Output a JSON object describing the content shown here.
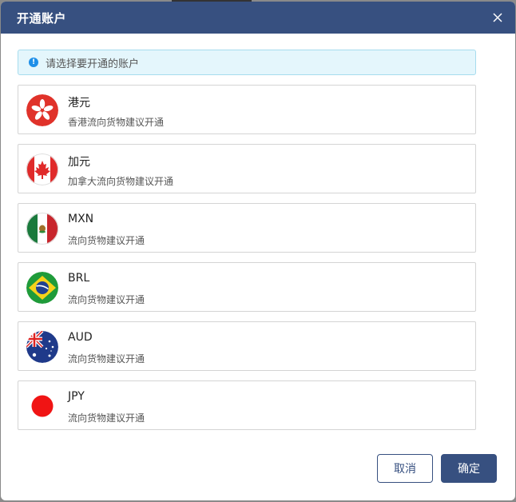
{
  "dialog": {
    "title": "开通账户"
  },
  "notice": {
    "text": "请选择要开通的账户"
  },
  "accounts": [
    {
      "currency": "港元",
      "description": "香港流向货物建议开通",
      "flag": "hong-kong-flag"
    },
    {
      "currency": "加元",
      "description": "加拿大流向货物建议开通",
      "flag": "canada-flag"
    },
    {
      "currency": "MXN",
      "description": "流向货物建议开通",
      "flag": "mexico-flag"
    },
    {
      "currency": "BRL",
      "description": "流向货物建议开通",
      "flag": "brazil-flag"
    },
    {
      "currency": "AUD",
      "description": "流向货物建议开通",
      "flag": "australia-flag"
    },
    {
      "currency": "JPY",
      "description": "流向货物建议开通",
      "flag": "japan-flag"
    }
  ],
  "buttons": {
    "cancel": "取消",
    "confirm": "确定"
  },
  "colors": {
    "header": "#375080",
    "notice_bg": "#e4f6fc",
    "notice_icon": "#1e8fe8"
  }
}
